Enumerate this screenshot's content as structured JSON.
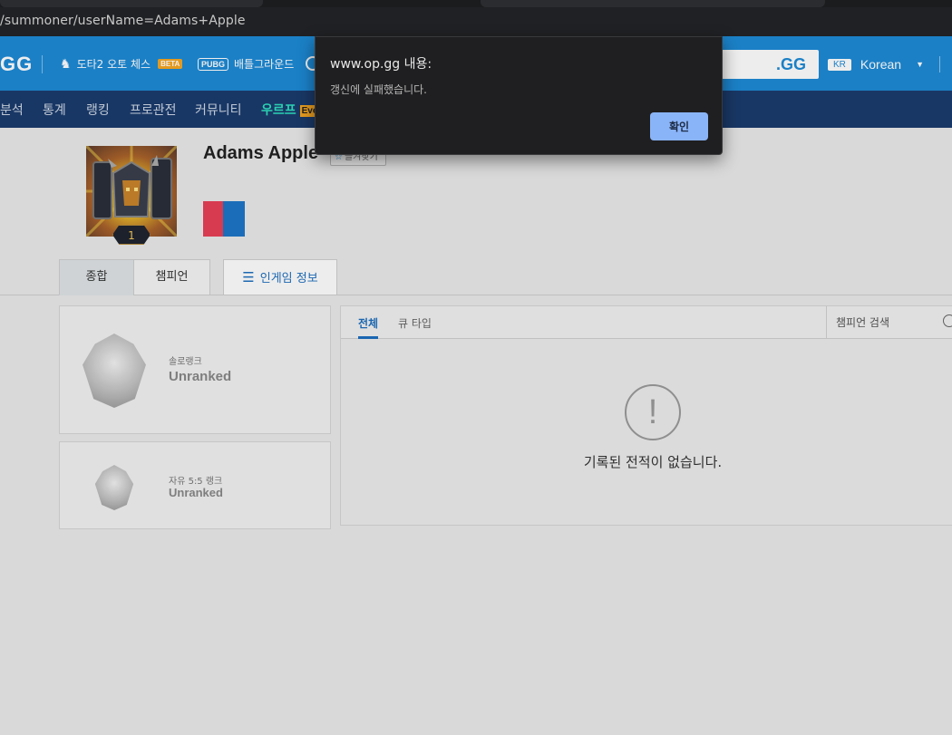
{
  "browser": {
    "url": "/summoner/userName=Adams+Apple"
  },
  "site": {
    "logo": "GG",
    "games": [
      {
        "label": "도타2 오토 체스",
        "badge": "BETA"
      },
      {
        "label": "배틀그라운드",
        "icon_text": "PUBG"
      }
    ],
    "search_suffix": ".GG",
    "region": "KR",
    "language": "Korean"
  },
  "subnav": {
    "items": [
      "분석",
      "통계",
      "랭킹",
      "프로관전",
      "커뮤니티"
    ],
    "accent_item": "우르프",
    "accent_badge": "Eve"
  },
  "profile": {
    "summoner_name": "Adams Apple",
    "level": "1",
    "favorite_label": "즐겨찾기"
  },
  "profile_tabs": {
    "summary": "종합",
    "champion": "챔피언",
    "ingame": "인게임 정보"
  },
  "ranks": {
    "solo": {
      "label": "솔로랭크",
      "value": "Unranked"
    },
    "flex": {
      "label": "자유 5:5 랭크",
      "value": "Unranked"
    }
  },
  "matches": {
    "tab_all": "전체",
    "tab_queue": "큐 타입",
    "champion_search": "챔피언 검색",
    "empty_icon": "!",
    "empty_message": "기록된 전적이 없습니다."
  },
  "dialog": {
    "title": "www.op.gg 내용:",
    "message": "갱신에 실패했습니다.",
    "ok_label": "확인"
  },
  "colors": {
    "brand_blue": "#1e8ad6",
    "subnav_navy": "#1b3c6d",
    "accent_teal": "#2fe0c0",
    "dialog_button": "#8ab4f8"
  }
}
